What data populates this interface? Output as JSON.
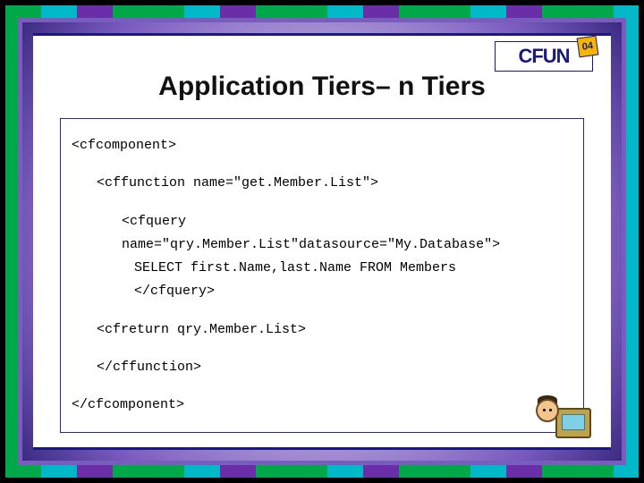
{
  "logo": {
    "text": "CFUN",
    "badge": "04"
  },
  "title": "Application Tiers– n Tiers",
  "code": {
    "l1": "<cfcomponent>",
    "l2": "<cffunction name=\"get.Member.List\">",
    "l3a": "<cfquery",
    "l3b": "name=\"qry.Member.List\"datasource=\"My.Database\">",
    "l4": "SELECT first.Name,last.Name FROM Members",
    "l5": "</cfquery>",
    "l6": "<cfreturn qry.Member.List>",
    "l7": "</cffunction>",
    "l8": "</cfcomponent>"
  }
}
